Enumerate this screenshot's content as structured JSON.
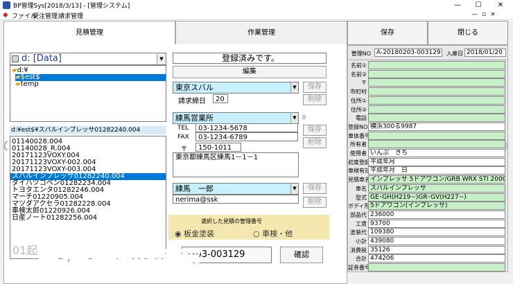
{
  "window": {
    "title": "BP管理Sys[2018/3/13] - [管理システム]",
    "controls": [
      "—",
      "☐",
      "✕"
    ],
    "mdi_controls": [
      "—",
      "▫",
      "×"
    ]
  },
  "menu": [
    "ファイル",
    "受注管理",
    "請求管理"
  ],
  "tabs": [
    "見積管理",
    "作業管理"
  ],
  "buttons": {
    "save": "保存",
    "close": "閉じる",
    "edit": "編集",
    "confirm": "確認",
    "save_small": "保存",
    "delete_small": "削除"
  },
  "left": {
    "drive": "d: [Data]",
    "tree": [
      "d:¥",
      "$est$",
      "temp"
    ],
    "path": "d:¥est$¥スバルインプレッサ01282240.004",
    "files": [
      "01140028.004",
      "01140028_R.004",
      "20171123VOXY.004",
      "20171123VOXY-002.004",
      "20171123VOXY-003.004",
      "スバルインプレッサ01282240.004",
      "ダイハツコペン01282234.004",
      "トヨタエンタ01282246.004",
      "マーチ01220905.004",
      "マツダアクセラ01282228.004",
      "車検太郎01220926.004",
      "日産ノート01282256.004"
    ]
  },
  "middle": {
    "status": "登録済みです。",
    "company": "東京スバル",
    "closing_label": "請求締日",
    "closing_day": "20",
    "branch": "練馬営業所",
    "tel_label": "TEL",
    "tel": "03-1234-5678",
    "fax_label": "FAX",
    "fax": "03-1234-6789",
    "postal_mark": "〒",
    "postal": "150-1011",
    "address": "東京都練馬区練馬1－1－1",
    "staff": "練馬　一郎",
    "email": "nerima@ssk",
    "manage_no_caption": "選択した見積の管理番号",
    "radio_1": "板金塗装",
    "radio_2": "車検・他",
    "manage_no_value": "0203-003129",
    "side_mark": "0"
  },
  "right": {
    "manage_no_label": "管理NO",
    "manage_no": "A-20180203-003129",
    "entry_date_label": "入庫日",
    "entry_date": "2018/01/20",
    "rows": [
      {
        "label": "名前①",
        "value": ""
      },
      {
        "label": "名前②",
        "value": ""
      },
      {
        "label": "〒",
        "value": ""
      },
      {
        "label": "市町村",
        "value": ""
      },
      {
        "label": "住所①",
        "value": ""
      },
      {
        "label": "住所②",
        "value": ""
      },
      {
        "label": "電話",
        "value": ""
      },
      {
        "label": "登録NO",
        "value": "横浜300る9987"
      },
      {
        "label": "車体番号",
        "value": ""
      },
      {
        "label": "所有者",
        "value": ""
      },
      {
        "label": "使用者",
        "value": "いんぷ　きち"
      },
      {
        "label": "初度登録",
        "value": "平成年月"
      },
      {
        "label": "車検有効",
        "value": "平成年月　日"
      },
      {
        "label": "見積車名",
        "value": "インプレッサ 5ドアワゴン/GRB WRX STI 2000"
      },
      {
        "label": "車名",
        "value": "スバルインプレッサ"
      },
      {
        "label": "型式",
        "value": "GE･GH(H219~)GR･GV(H227~)"
      },
      {
        "label": "ボディ形状",
        "value": "5ドアワゴン(インプレッサ)"
      },
      {
        "label": "部品代",
        "value": "236000"
      },
      {
        "label": "工賃",
        "value": "93700"
      },
      {
        "label": "塗装代",
        "value": "109380"
      },
      {
        "label": "小計",
        "value": "439080"
      },
      {
        "label": "消費税",
        "value": "35126"
      },
      {
        "label": "合計",
        "value": "474206"
      },
      {
        "label": "証券番号",
        "value": ""
      }
    ]
  },
  "overlay": {
    "caption": "見積管理画面",
    "ghost": "01起"
  },
  "colors": {
    "accent": "#0078d7",
    "combo": "#c8f0fc",
    "green_field": "#c8f0c8",
    "caption": "#e02020"
  }
}
